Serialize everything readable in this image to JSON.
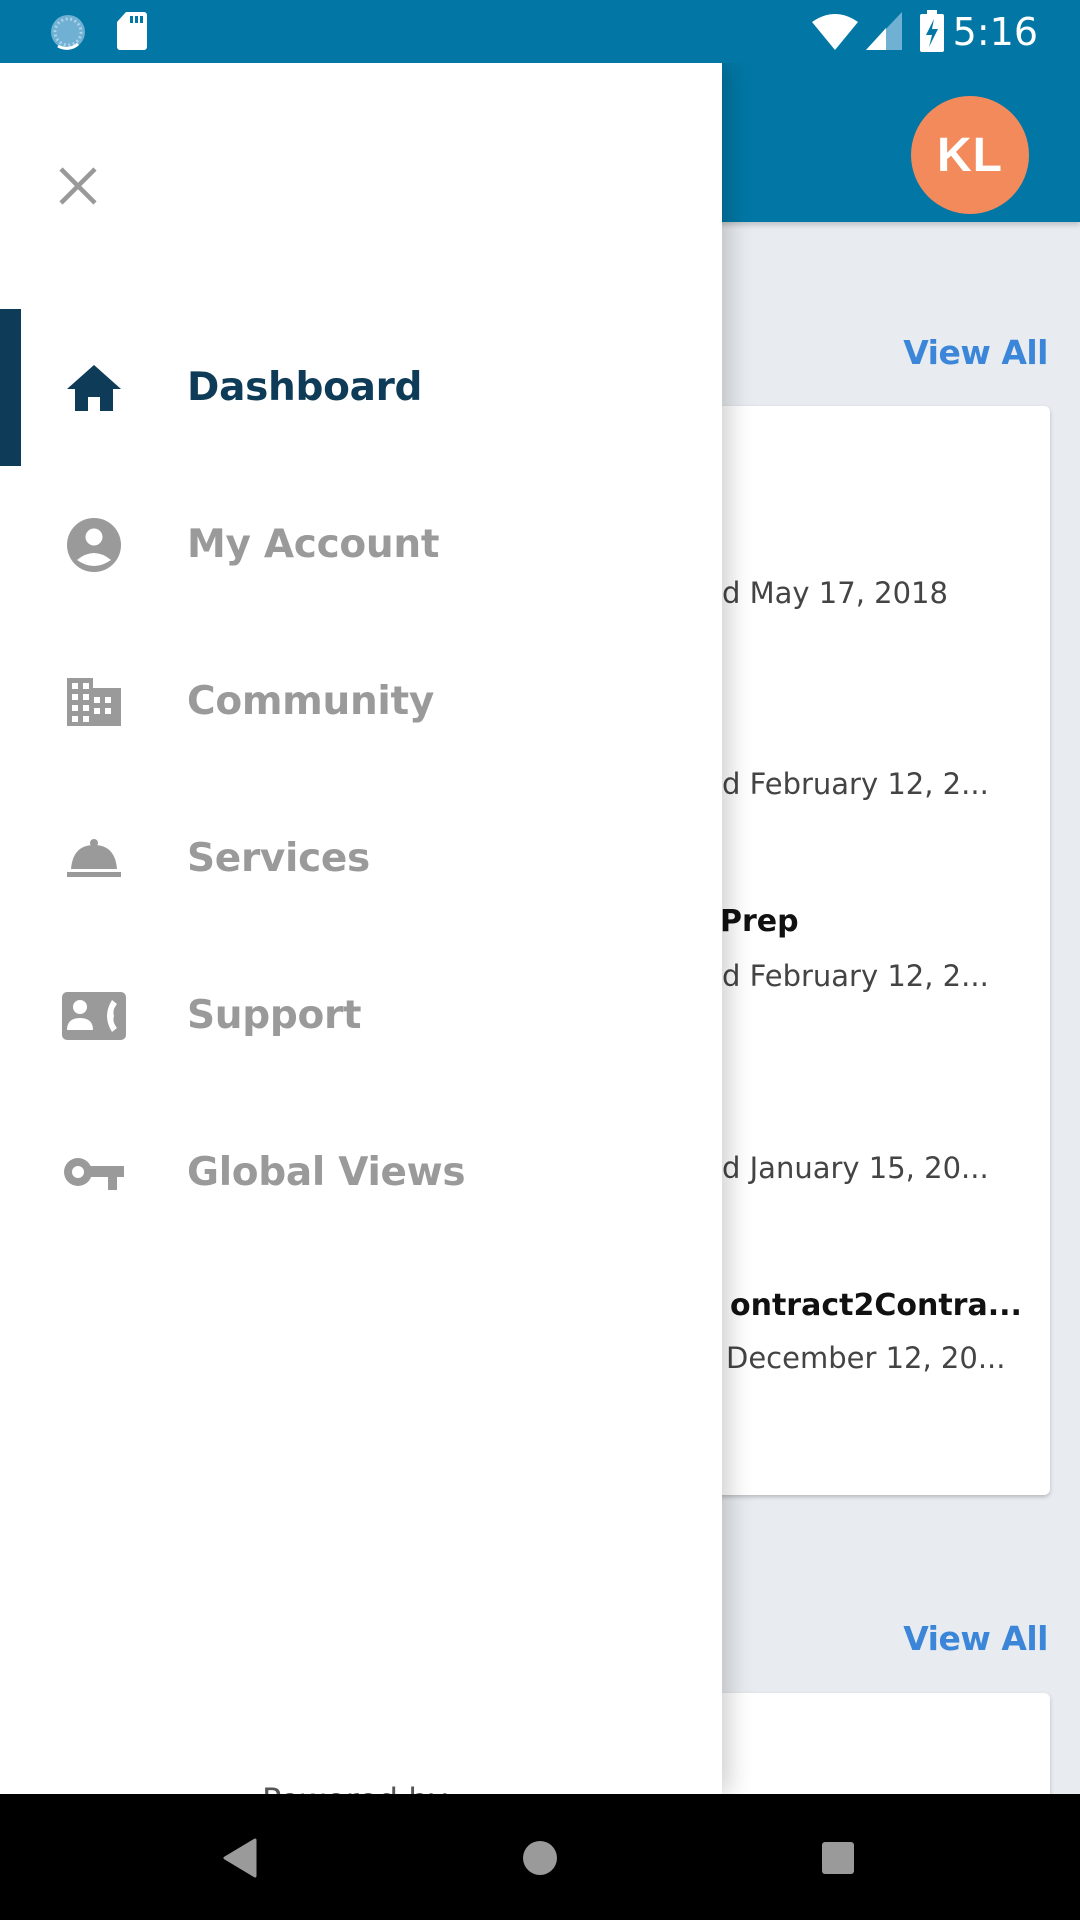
{
  "status_bar": {
    "time": "5:16",
    "left_icons": [
      "sync-icon",
      "sd-card-icon"
    ],
    "right_icons": [
      "wifi-icon",
      "cell-signal-icon",
      "battery-charging-icon"
    ]
  },
  "header": {
    "avatar_initials": "KL",
    "avatar_color": "#f28a5b",
    "bar_color": "#0277a5"
  },
  "drawer": {
    "close_icon": "close-icon",
    "active_color": "#0e3b57",
    "items": [
      {
        "label": "Dashboard",
        "icon": "home-icon",
        "active": true
      },
      {
        "label": "My Account",
        "icon": "account-circle-icon",
        "active": false
      },
      {
        "label": "Community",
        "icon": "building-icon",
        "active": false
      },
      {
        "label": "Services",
        "icon": "room-service-icon",
        "active": false
      },
      {
        "label": "Support",
        "icon": "contact-phone-icon",
        "active": false
      },
      {
        "label": "Global Views",
        "icon": "key-icon",
        "active": false
      }
    ],
    "footer": "Powered by"
  },
  "main": {
    "sections": [
      {
        "view_all_label": "View All",
        "card_lines": [
          {
            "kind": "sub",
            "text": "d May 17, 2018"
          },
          {
            "kind": "sub",
            "text": "d February 12, 2..."
          },
          {
            "kind": "title",
            "text": "Prep"
          },
          {
            "kind": "sub",
            "text": "d February 12, 2..."
          },
          {
            "kind": "sub",
            "text": "d January 15, 20..."
          },
          {
            "kind": "title",
            "text": "ontract2Contra..."
          },
          {
            "kind": "sub",
            "text": "December 12, 20..."
          }
        ]
      },
      {
        "view_all_label": "View All",
        "card_lines": []
      }
    ]
  },
  "nav_bar": {
    "buttons": [
      "back-icon",
      "home-circle-icon",
      "recents-icon"
    ]
  }
}
